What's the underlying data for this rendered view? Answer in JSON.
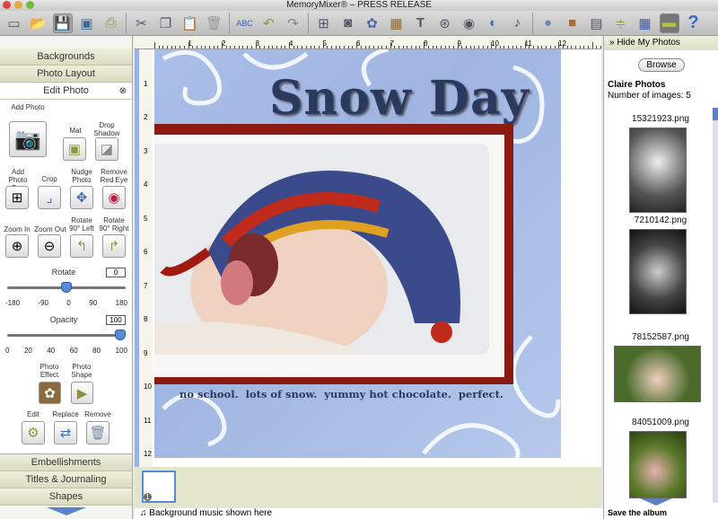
{
  "window": {
    "title": "MemoryMixer® – PRESS RELEASE"
  },
  "toolbar": {
    "items": [
      "new-album",
      "open",
      "save",
      "export-slideshow",
      "print",
      "cut",
      "copy",
      "paste",
      "delete",
      "spell-check",
      "undo",
      "redo",
      "add-page",
      "add-photo-box",
      "add-embellishment",
      "add-frame",
      "add-text",
      "add-film",
      "add-audio",
      "add-shape",
      "add-clip",
      "bring-forward",
      "send-backward",
      "page-setup",
      "align",
      "grid",
      "ruler",
      "help"
    ],
    "selected": [
      "save",
      "ruler"
    ]
  },
  "left_panel": {
    "sections_top": [
      "Backgrounds",
      "Photo Layout"
    ],
    "edit_photo": {
      "title": "Edit Photo",
      "buttons": {
        "add_photo": "Add Photo",
        "mat": "Mat",
        "drop_shadow": "Drop Shadow",
        "add_photo_box": "Add Photo Box",
        "crop": "Crop",
        "nudge_photo": "Nudge Photo",
        "remove_red_eye": "Remove Red Eye",
        "zoom_in": "Zoom In",
        "zoom_out": "Zoom Out",
        "rotate_left": "Rotate 90° Left",
        "rotate_right": "Rotate 90° Right",
        "photo_effect": "Photo Effect",
        "photo_shape": "Photo Shape",
        "edit": "Edit",
        "replace": "Replace",
        "remove": "Remove"
      },
      "rotate": {
        "label": "Rotate",
        "value": "0",
        "ticks": [
          "-180",
          "-90",
          "0",
          "90",
          "180"
        ],
        "fraction": 0.5
      },
      "opacity": {
        "label": "Opacity",
        "value": "100",
        "ticks": [
          "0",
          "20",
          "40",
          "60",
          "80",
          "100"
        ],
        "fraction": 1.0
      }
    },
    "sections_bottom": [
      "Embellishments",
      "Titles & Journaling",
      "Shapes"
    ]
  },
  "ruler": {
    "top": [
      "1",
      "2",
      "3",
      "4",
      "5",
      "6",
      "7",
      "8",
      "9",
      "10",
      "11",
      "12"
    ],
    "left": [
      "1",
      "2",
      "3",
      "4",
      "5",
      "6",
      "7",
      "8",
      "9",
      "10",
      "11",
      "12"
    ]
  },
  "page": {
    "title": "Snow Day",
    "caption": "no school.  lots of snow.  yummy hot chocolate.  perfect."
  },
  "filmstrip": {
    "page_number": "1"
  },
  "status": {
    "music": "Background music shown here"
  },
  "right_panel": {
    "hide_label": "» Hide My Photos",
    "browse": "Browse",
    "album": "Claire Photos",
    "count": "Number of images: 5",
    "photos": [
      "15321923.png",
      "7210142.png",
      "78152587.png",
      "84051009.png"
    ],
    "save": "Save the album"
  },
  "colors": {
    "title": "#2b3a5c",
    "frame_red": "#8a1a12",
    "accordion": "#e3e6cc",
    "page_blue": "#a9bfe8"
  }
}
